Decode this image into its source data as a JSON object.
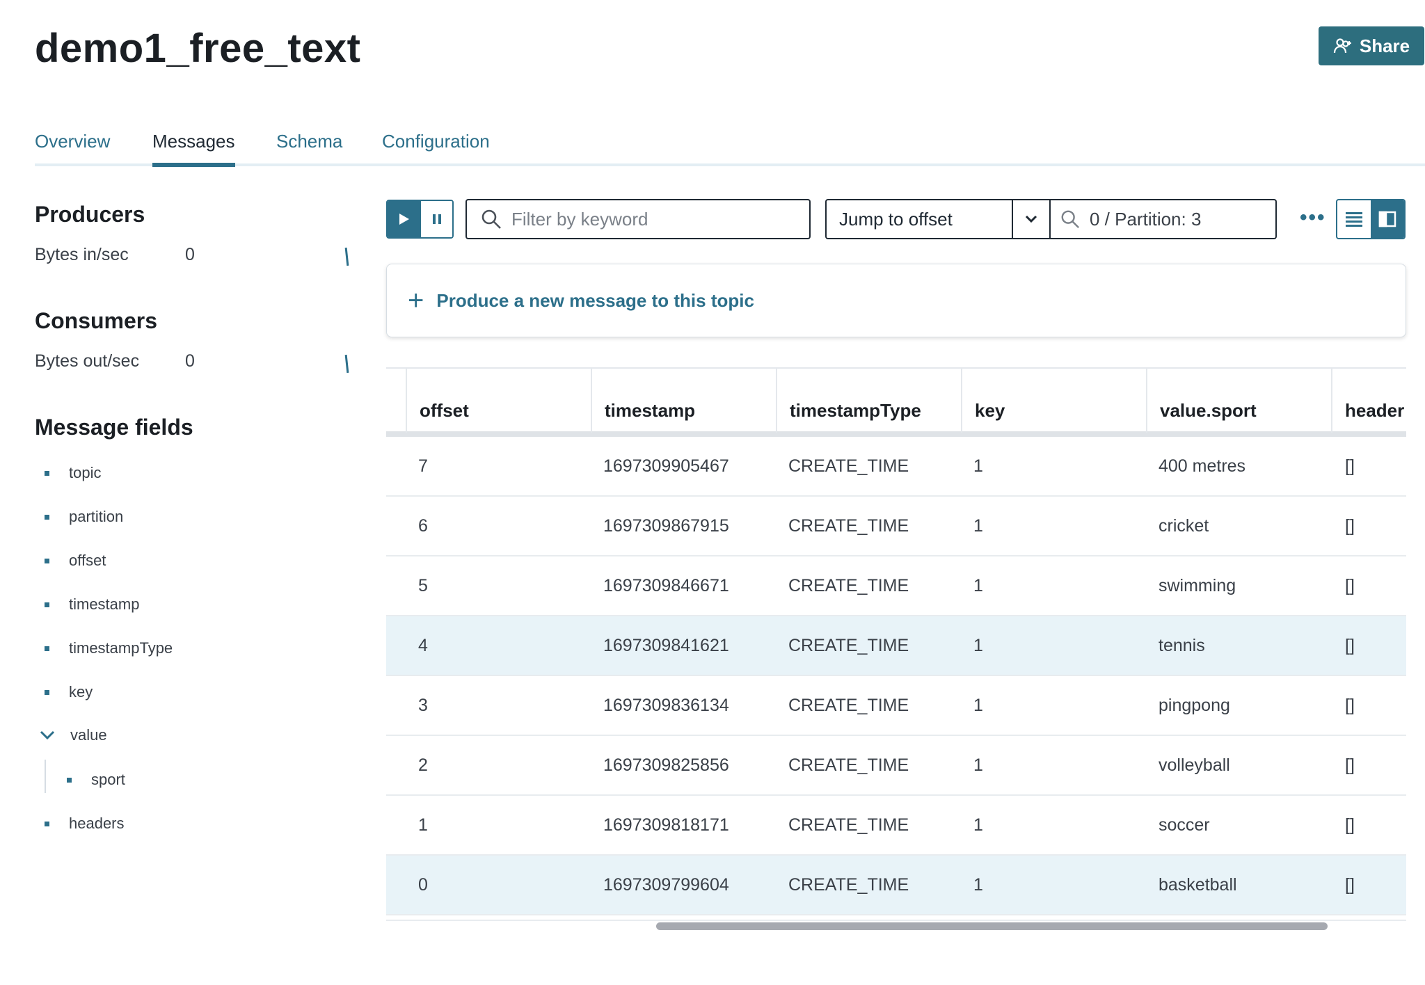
{
  "header": {
    "title": "demo1_free_text",
    "share_label": "Share"
  },
  "tabs": [
    {
      "label": "Overview",
      "active": false
    },
    {
      "label": "Messages",
      "active": true
    },
    {
      "label": "Schema",
      "active": false
    },
    {
      "label": "Configuration",
      "active": false
    }
  ],
  "sidebar": {
    "producers": {
      "title": "Producers",
      "metric_label": "Bytes in/sec",
      "metric_value": "0"
    },
    "consumers": {
      "title": "Consumers",
      "metric_label": "Bytes out/sec",
      "metric_value": "0"
    },
    "message_fields": {
      "title": "Message fields",
      "items": [
        "topic",
        "partition",
        "offset",
        "timestamp",
        "timestampType",
        "key",
        "value",
        "headers"
      ],
      "value_children": [
        "sport"
      ]
    }
  },
  "toolbar": {
    "filter_placeholder": "Filter by keyword",
    "jump_label": "Jump to offset",
    "partition_text": "0 / Partition: 3",
    "more_label": "•••"
  },
  "produce": {
    "label": "Produce a new message to this topic"
  },
  "table": {
    "columns": [
      "offset",
      "timestamp",
      "timestampType",
      "key",
      "value.sport",
      "header"
    ],
    "rows": [
      [
        "7",
        "1697309905467",
        "CREATE_TIME",
        "1",
        "400 metres",
        "[]"
      ],
      [
        "6",
        "1697309867915",
        "CREATE_TIME",
        "1",
        "cricket",
        "[]"
      ],
      [
        "5",
        "1697309846671",
        "CREATE_TIME",
        "1",
        "swimming",
        "[]"
      ],
      [
        "4",
        "1697309841621",
        "CREATE_TIME",
        "1",
        "tennis",
        "[]"
      ],
      [
        "3",
        "1697309836134",
        "CREATE_TIME",
        "1",
        "pingpong",
        "[]"
      ],
      [
        "2",
        "1697309825856",
        "CREATE_TIME",
        "1",
        "volleyball",
        "[]"
      ],
      [
        "1",
        "1697309818171",
        "CREATE_TIME",
        "1",
        "soccer",
        "[]"
      ],
      [
        "0",
        "1697309799604",
        "CREATE_TIME",
        "1",
        "basketball",
        "[]"
      ]
    ],
    "highlighted_rows": [
      3,
      7
    ]
  },
  "colors": {
    "accent": "#2c6f8a",
    "share_bg": "#2d6e7e",
    "row_highlight": "#e8f3f8"
  }
}
